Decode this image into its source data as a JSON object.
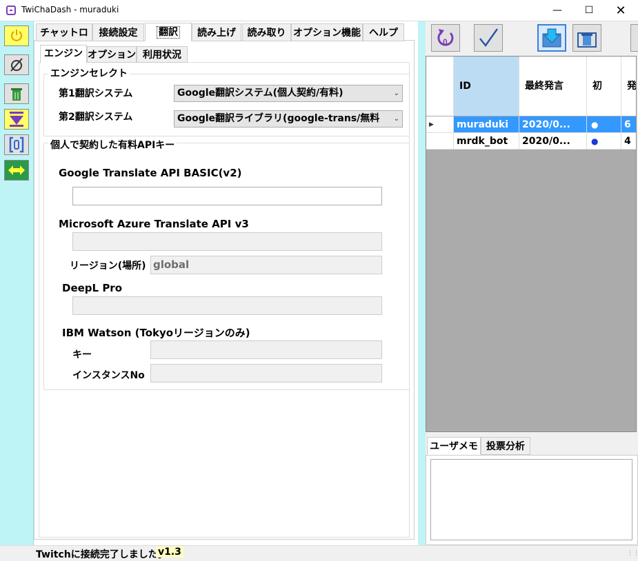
{
  "window": {
    "title": "TwiChaDash - muraduki"
  },
  "main_tabs": [
    "チャットログ",
    "接続設定",
    "翻訳",
    "読み上げ",
    "読み取り",
    "オプション機能",
    "ヘルプ"
  ],
  "sub_tabs": [
    "エンジン",
    "オプション",
    "利用状況"
  ],
  "engine_select": {
    "legend": "エンジンセレクト",
    "primary_label": "第1翻訳システム",
    "primary_value": "Google翻訳システム(個人契約/有料)",
    "secondary_label": "第2翻訳システム",
    "secondary_value": "Google翻訳ライブラリ(google-trans/無料"
  },
  "api_keys": {
    "legend": "個人で契約した有料APIキー",
    "google_label": "Google Translate API BASIC(v2)",
    "google_value": "",
    "azure_label": "Microsoft Azure Translate API v3",
    "azure_value": "",
    "region_label": "リージョン(場所)",
    "region_value": "global",
    "deepl_label": "DeepL Pro",
    "deepl_value": "",
    "watson_label": "IBM Watson (Tokyoリージョンのみ)",
    "watson_key_label": "キー",
    "watson_key_value": "",
    "watson_instance_label": "インスタンスNo",
    "watson_instance_value": ""
  },
  "user_grid": {
    "columns": [
      "ID",
      "最終発言",
      "初",
      "発"
    ],
    "rows": [
      {
        "id": "muraduki",
        "last": "2020/0...",
        "first": "●",
        "count": "6",
        "selected": true
      },
      {
        "id": "mrdk_bot",
        "last": "2020/0...",
        "first": "●",
        "count": "4",
        "selected": false
      }
    ]
  },
  "memo_tabs": [
    "ユーザメモ",
    "投票分析"
  ],
  "status": {
    "text": "Twitchに接続完了しました。",
    "version": "v1.3"
  },
  "colors": {
    "toolbar_bg": "#bff4f7",
    "selection": "#3399ff",
    "power_btn": "#ffff66",
    "download_btn": "#ffff66"
  },
  "icons": [
    "power-icon",
    "hide-icon",
    "trash-icon",
    "download-arrow-icon",
    "bracket-icon",
    "swap-icon",
    "refresh-icon",
    "check-icon",
    "save-download-icon",
    "trash-all-icon"
  ]
}
